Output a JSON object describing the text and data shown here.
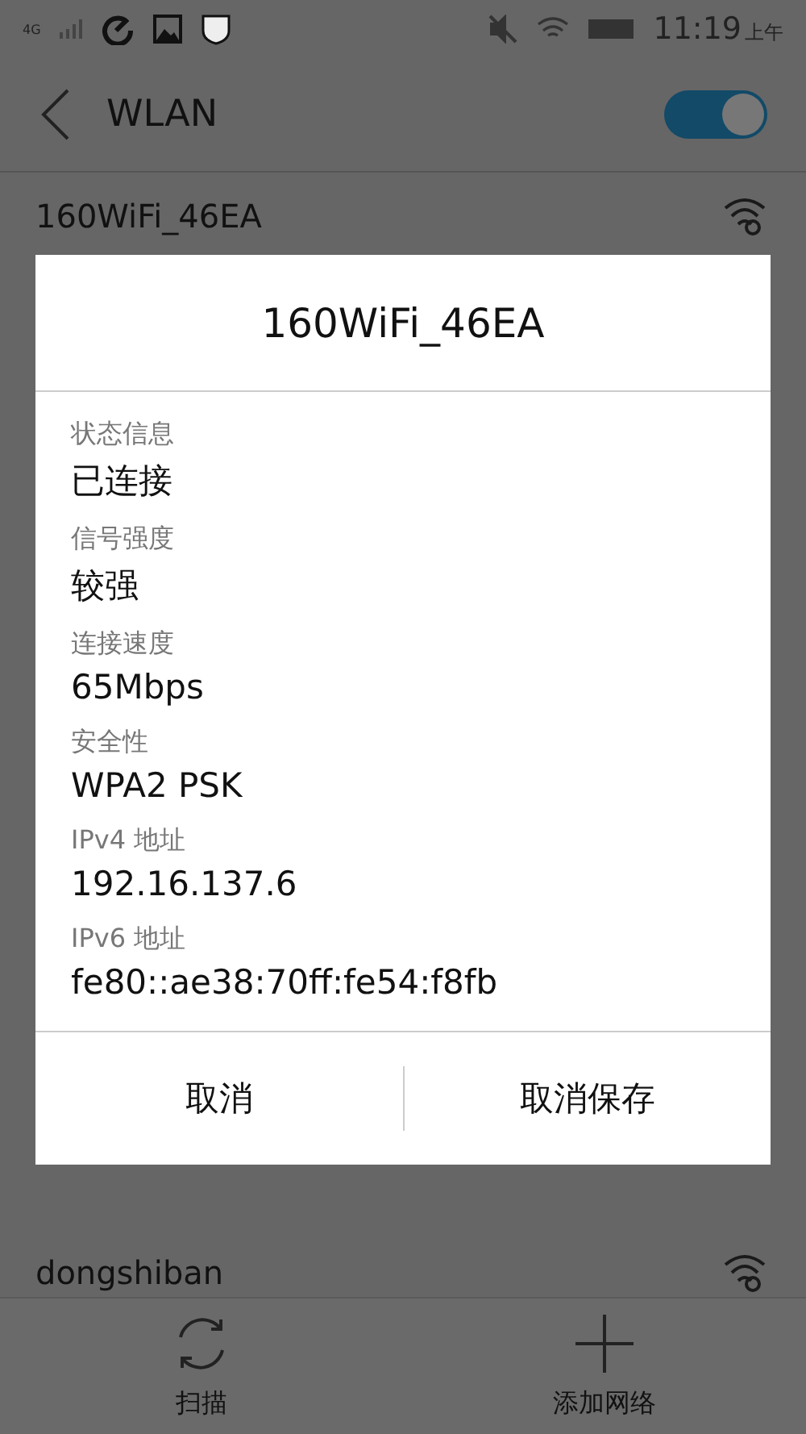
{
  "status_bar": {
    "network": "4G",
    "time": "11:19",
    "time_suffix": "上午"
  },
  "header": {
    "title": "WLAN",
    "wlan_on": true
  },
  "networks": [
    {
      "name": "160WiFi_46EA"
    },
    {
      "name": "dongshiban"
    }
  ],
  "dialog": {
    "title": "160WiFi_46EA",
    "fields": [
      {
        "label": "状态信息",
        "value": "已连接"
      },
      {
        "label": "信号强度",
        "value": "较强"
      },
      {
        "label": "连接速度",
        "value": "65Mbps"
      },
      {
        "label": "安全性",
        "value": "WPA2 PSK"
      },
      {
        "label": "IPv4 地址",
        "value": "192.16.137.6"
      },
      {
        "label": "IPv6 地址",
        "value": "fe80::ae38:70ff:fe54:f8fb"
      }
    ],
    "buttons": [
      "取消",
      "取消保存"
    ]
  },
  "bottom_bar": [
    {
      "label": "扫描",
      "kind": "scan"
    },
    {
      "label": "添加网络",
      "kind": "add"
    }
  ]
}
